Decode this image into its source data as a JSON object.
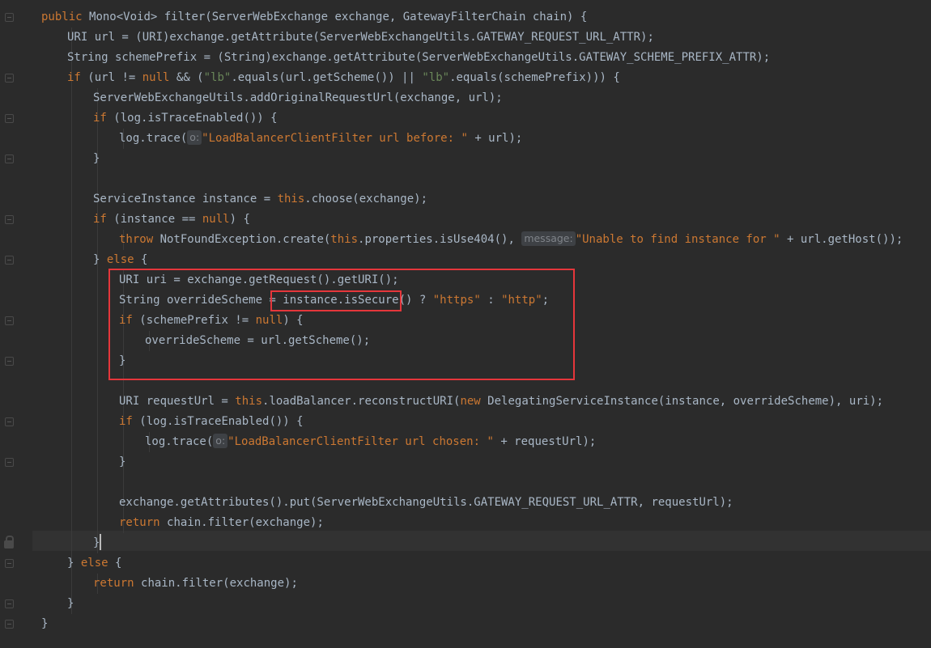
{
  "editor": {
    "colors": {
      "background": "#2b2b2b",
      "text": "#a9b7c6",
      "keyword": "#cc7832",
      "string": "#6a8759",
      "highlight_box": "#e5363b"
    },
    "lines": [
      {
        "segs": [
          [
            "kw",
            "public "
          ],
          [
            "t",
            "Mono<Void> filter(ServerWebExchange exchange, GatewayFilterChain chain) {"
          ]
        ]
      },
      {
        "segs": [
          [
            "t",
            "URI url = (URI)exchange.getAttribute(ServerWebExchangeUtils.GATEWAY_REQUEST_URL_ATTR);"
          ]
        ]
      },
      {
        "segs": [
          [
            "t",
            "String schemePrefix = (String)exchange.getAttribute(ServerWebExchangeUtils.GATEWAY_SCHEME_PREFIX_ATTR);"
          ]
        ]
      },
      {
        "segs": [
          [
            "kw",
            "if "
          ],
          [
            "t",
            "(url != "
          ],
          [
            "kw",
            "null "
          ],
          [
            "t",
            "&& ("
          ],
          [
            "str",
            "\"lb\""
          ],
          [
            "t",
            ".equals(url.getScheme()) || "
          ],
          [
            "str",
            "\"lb\""
          ],
          [
            "t",
            ".equals(schemePrefix))) {"
          ]
        ]
      },
      {
        "segs": [
          [
            "t",
            "ServerWebExchangeUtils.addOriginalRequestUrl(exchange, url);"
          ]
        ]
      },
      {
        "segs": [
          [
            "kw",
            "if "
          ],
          [
            "t",
            "(log.isTraceEnabled()) {"
          ]
        ]
      },
      {
        "segs": [
          [
            "t",
            "log.trace("
          ],
          [
            "hint",
            "o:"
          ],
          [
            "ostr",
            "\"LoadBalancerClientFilter url before: \""
          ],
          [
            "t",
            " + url);"
          ]
        ]
      },
      {
        "segs": [
          [
            "t",
            "}"
          ]
        ]
      },
      {
        "segs": []
      },
      {
        "segs": [
          [
            "t",
            "ServiceInstance instance = "
          ],
          [
            "kw",
            "this"
          ],
          [
            "t",
            ".choose(exchange);"
          ]
        ]
      },
      {
        "segs": [
          [
            "kw",
            "if "
          ],
          [
            "t",
            "(instance == "
          ],
          [
            "kw",
            "null"
          ],
          [
            "t",
            ") {"
          ]
        ]
      },
      {
        "segs": [
          [
            "kw",
            "throw "
          ],
          [
            "t",
            "NotFoundException.create("
          ],
          [
            "kw",
            "this"
          ],
          [
            "t",
            ".properties.isUse404(), "
          ],
          [
            "hint",
            "message:"
          ],
          [
            "ostr",
            "\"Unable to find instance for \""
          ],
          [
            "t",
            " + url.getHost());"
          ]
        ]
      },
      {
        "segs": [
          [
            "t",
            "} "
          ],
          [
            "kw",
            "else "
          ],
          [
            "t",
            "{"
          ]
        ]
      },
      {
        "segs": [
          [
            "t",
            "URI uri = exchange.getRequest().getURI();"
          ]
        ]
      },
      {
        "segs": [
          [
            "t",
            "String overrideScheme = "
          ],
          [
            "t",
            "instance.isSecure()"
          ],
          [
            "t",
            " ? "
          ],
          [
            "ostr",
            "\"https\""
          ],
          [
            "t",
            " : "
          ],
          [
            "ostr",
            "\"http\""
          ],
          [
            "t",
            ";"
          ]
        ]
      },
      {
        "segs": [
          [
            "kw",
            "if "
          ],
          [
            "t",
            "(schemePrefix != "
          ],
          [
            "kw",
            "null"
          ],
          [
            "t",
            ") {"
          ]
        ]
      },
      {
        "segs": [
          [
            "t",
            "overrideScheme = url.getScheme();"
          ]
        ]
      },
      {
        "segs": [
          [
            "t",
            "}"
          ]
        ]
      },
      {
        "segs": []
      },
      {
        "segs": [
          [
            "t",
            "URI requestUrl = "
          ],
          [
            "kw",
            "this"
          ],
          [
            "t",
            ".loadBalancer.reconstructURI("
          ],
          [
            "kw",
            "new "
          ],
          [
            "t",
            "DelegatingServiceInstance(instance, overrideScheme), uri);"
          ]
        ]
      },
      {
        "segs": [
          [
            "kw",
            "if "
          ],
          [
            "t",
            "(log.isTraceEnabled()) {"
          ]
        ]
      },
      {
        "segs": [
          [
            "t",
            "log.trace("
          ],
          [
            "hint",
            "o:"
          ],
          [
            "ostr",
            "\"LoadBalancerClientFilter url chosen: \""
          ],
          [
            "t",
            " + requestUrl);"
          ]
        ]
      },
      {
        "segs": [
          [
            "t",
            "}"
          ]
        ]
      },
      {
        "segs": []
      },
      {
        "segs": [
          [
            "t",
            "exchange.getAttributes().put(ServerWebExchangeUtils.GATEWAY_REQUEST_URL_ATTR, requestUrl);"
          ]
        ]
      },
      {
        "segs": [
          [
            "kw",
            "return "
          ],
          [
            "t",
            "chain.filter(exchange);"
          ]
        ]
      },
      {
        "segs": [
          [
            "t",
            "}"
          ],
          [
            "caret",
            ""
          ]
        ]
      },
      {
        "segs": [
          [
            "t",
            "} "
          ],
          [
            "kw",
            "else "
          ],
          [
            "t",
            "{"
          ]
        ]
      },
      {
        "segs": [
          [
            "kw",
            "return "
          ],
          [
            "t",
            "chain.filter(exchange);"
          ]
        ]
      },
      {
        "segs": [
          [
            "t",
            "}"
          ]
        ]
      },
      {
        "segs": [
          [
            "t",
            "}"
          ]
        ]
      }
    ],
    "fold_icons": [
      "fold-marker-icon"
    ],
    "lock_icon": "lock-icon"
  }
}
